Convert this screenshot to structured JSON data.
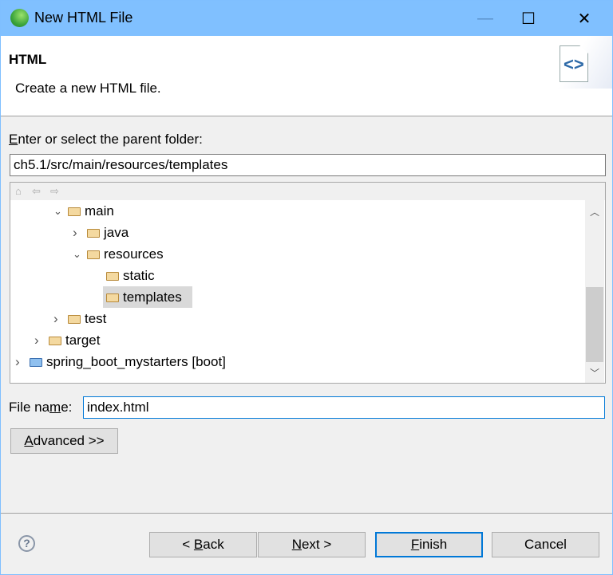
{
  "window": {
    "title": "New HTML File",
    "minimize": "—",
    "maximize": "☐",
    "close": "✕"
  },
  "header": {
    "title": "HTML",
    "description": "Create a new HTML file.",
    "icon": "html-file-icon"
  },
  "parent_folder": {
    "label_key": "E",
    "label_rest": "nter or select the parent folder:",
    "value": "ch5.1/src/main/resources/templates"
  },
  "tree": {
    "toolbar": {
      "home": "⌂",
      "back": "⇦",
      "forward": "⇨"
    },
    "items": [
      {
        "label": "main",
        "expanded": true,
        "level": 2
      },
      {
        "label": "java",
        "expanded": false,
        "level": 3
      },
      {
        "label": "resources",
        "expanded": true,
        "level": 3
      },
      {
        "label": "static",
        "level": 4
      },
      {
        "label": "templates",
        "level": 4,
        "selected": true
      },
      {
        "label": "test",
        "expanded": false,
        "level": 2
      },
      {
        "label": "target",
        "expanded": false,
        "level": 1
      },
      {
        "label": "spring_boot_mystarters [boot]",
        "expanded": false,
        "level": 0,
        "project": true
      }
    ]
  },
  "file_name": {
    "label_pre": "File na",
    "label_key": "m",
    "label_post": "e:",
    "value": "index.html"
  },
  "buttons": {
    "advanced": {
      "key": "A",
      "rest": "dvanced >>"
    },
    "back": {
      "pre": "< ",
      "key": "B",
      "rest": "ack"
    },
    "next": {
      "key": "N",
      "rest": "ext >"
    },
    "finish": {
      "key": "F",
      "rest": "inish"
    },
    "cancel": "Cancel",
    "help": "?"
  }
}
